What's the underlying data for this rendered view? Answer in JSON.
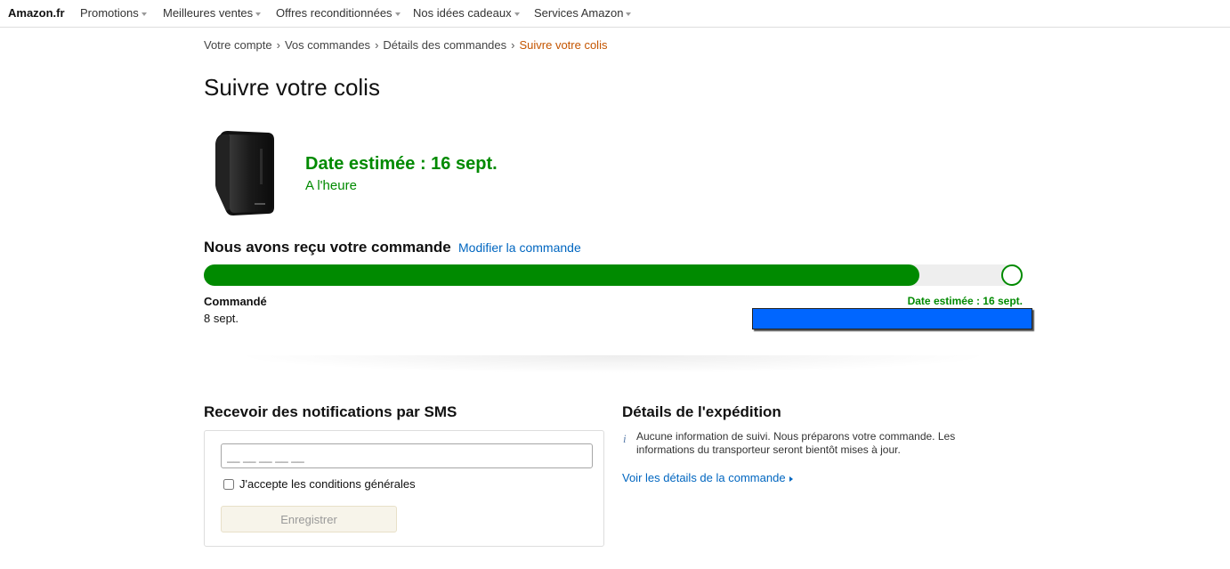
{
  "nav": {
    "brand": "Amazon.fr",
    "items": [
      "Promotions",
      "Meilleures ventes",
      "Offres reconditionnées",
      "Nos idées cadeaux",
      "Services Amazon"
    ]
  },
  "breadcrumb": [
    "Votre compte",
    "Vos commandes",
    "Détails des commandes",
    "Suivre votre colis"
  ],
  "page_title": "Suivre votre colis",
  "delivery": {
    "estimated": "Date estimée : 16 sept.",
    "status": "A l'heure"
  },
  "tracking": {
    "title": "Nous avons reçu votre commande",
    "modify_link": "Modifier la commande",
    "progress_fraction": 0.884,
    "start_label": "Commandé",
    "start_date": "8 sept.",
    "end_label": "Date estimée : 16 sept."
  },
  "sms": {
    "title": "Recevoir des notifications par SMS",
    "phone_placeholder": "__ __ __ __ __",
    "terms_label": "J'accepte les conditions générales",
    "save_button": "Enregistrer"
  },
  "shipping": {
    "title": "Détails de l'expédition",
    "info_icon": "i",
    "info_text": "Aucune information de suivi. Nous préparons votre commande. Les informations du transporteur seront bientôt mises à jour.",
    "details_link": "Voir les détails de la commande"
  },
  "colors": {
    "green": "#008a00",
    "link": "#0066c0",
    "breadcrumb_current": "#c45500",
    "redaction_bar": "#0066ff"
  }
}
